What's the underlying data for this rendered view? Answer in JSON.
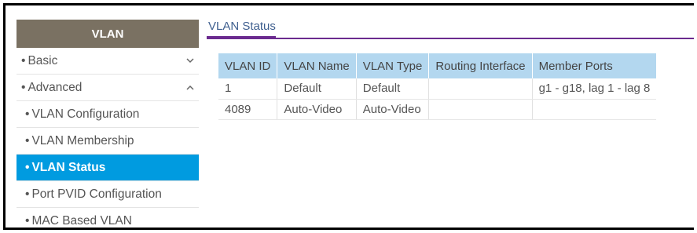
{
  "sidebar": {
    "header": "VLAN",
    "items": [
      {
        "label": "Basic",
        "bullet": "•",
        "level": "top",
        "chevron": "down"
      },
      {
        "label": "Advanced",
        "bullet": "•",
        "level": "top",
        "chevron": "up"
      },
      {
        "label": "VLAN Configuration",
        "bullet": "•",
        "level": "sub"
      },
      {
        "label": "VLAN Membership",
        "bullet": "•",
        "level": "sub"
      },
      {
        "label": "VLAN Status",
        "bullet": "•",
        "level": "sub",
        "active": true
      },
      {
        "label": "Port PVID Configuration",
        "bullet": "•",
        "level": "sub"
      },
      {
        "label": "MAC Based VLAN",
        "bullet": "•",
        "level": "sub"
      }
    ]
  },
  "main": {
    "title": "VLAN Status",
    "table": {
      "headers": [
        "VLAN ID",
        "VLAN Name",
        "VLAN Type",
        "Routing Interface",
        "Member Ports"
      ],
      "rows": [
        [
          "1",
          "Default",
          "Default",
          "",
          "g1 - g18, lag 1 - lag 8"
        ],
        [
          "4089",
          "Auto-Video",
          "Auto-Video",
          "",
          ""
        ]
      ]
    }
  },
  "colors": {
    "sidebar_header": "#7a7162",
    "active_item": "#009be0",
    "table_header": "#b3d7ef",
    "tab_underline": "#6b2b8f"
  },
  "icons": {
    "collapsed": "chevron-down-icon",
    "expanded": "chevron-up-icon"
  }
}
